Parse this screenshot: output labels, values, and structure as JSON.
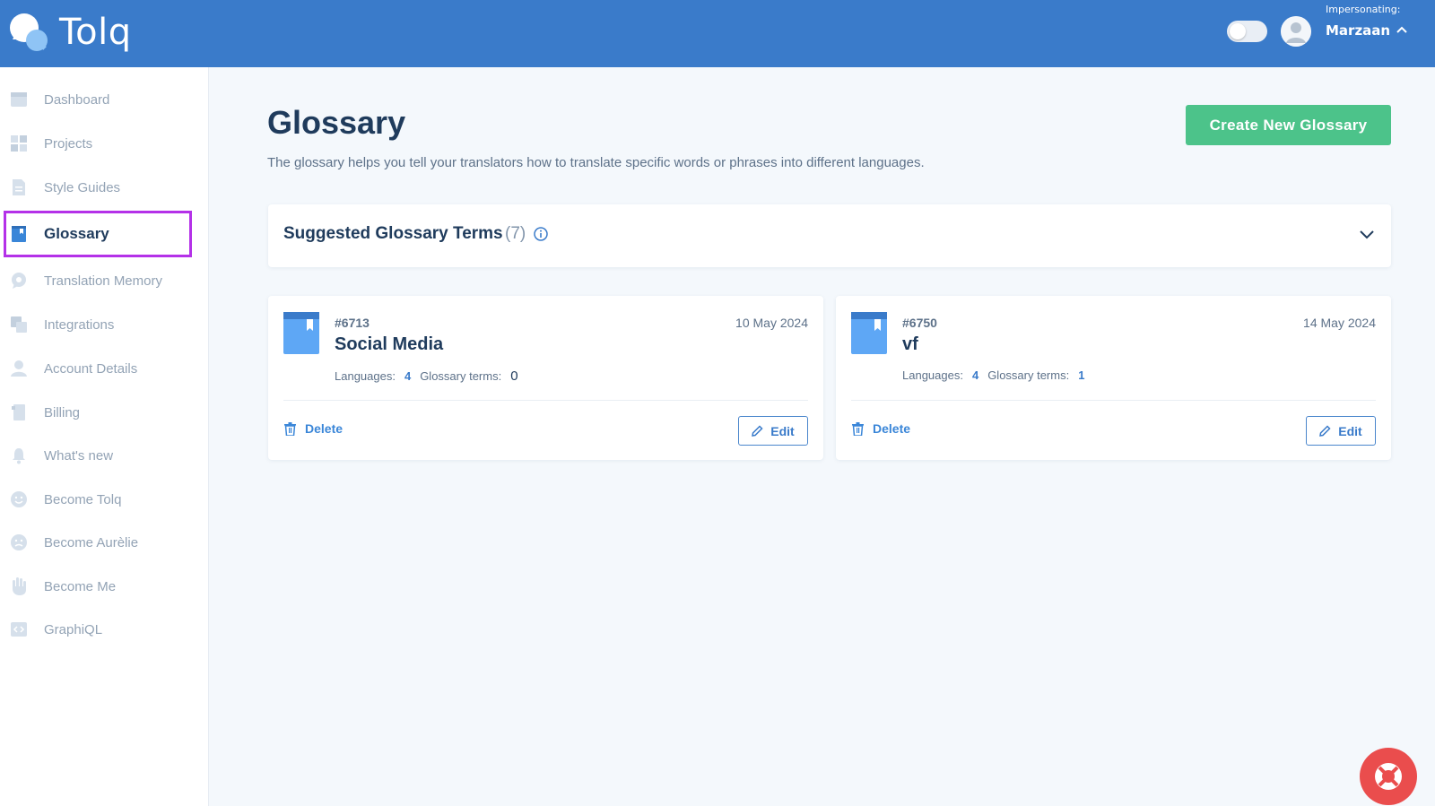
{
  "app": {
    "brand": "Tolq",
    "impersonating_label": "Impersonating:",
    "user_name": "Marzaan"
  },
  "sidebar": {
    "items": [
      {
        "label": "Dashboard",
        "icon": "dashboard-icon"
      },
      {
        "label": "Projects",
        "icon": "projects-grid-icon"
      },
      {
        "label": "Style Guides",
        "icon": "document-icon"
      },
      {
        "label": "Glossary",
        "icon": "book-icon",
        "active": true
      },
      {
        "label": "Translation Memory",
        "icon": "chat-bubble-icon"
      },
      {
        "label": "Integrations",
        "icon": "integrations-icon"
      },
      {
        "label": "Account Details",
        "icon": "person-icon"
      },
      {
        "label": "Billing",
        "icon": "receipt-icon"
      },
      {
        "label": "What's new",
        "icon": "bell-icon"
      },
      {
        "label": "Become Tolq",
        "icon": "smile-face-icon"
      },
      {
        "label": "Become Aurèlie",
        "icon": "sad-face-icon"
      },
      {
        "label": "Become Me",
        "icon": "hand-icon"
      },
      {
        "label": "GraphiQL",
        "icon": "code-icon"
      }
    ]
  },
  "main": {
    "title": "Glossary",
    "description": "The glossary helps you tell your translators how to translate specific words or phrases into different languages.",
    "create_button": "Create New Glossary",
    "suggested": {
      "title": "Suggested Glossary Terms",
      "count": "(7)"
    },
    "cards": [
      {
        "id": "#6713",
        "date": "10 May 2024",
        "name": "Social Media",
        "languages_label": "Languages:",
        "languages": "4",
        "terms_label": "Glossary terms:",
        "terms": "0",
        "delete_label": "Delete",
        "edit_label": "Edit"
      },
      {
        "id": "#6750",
        "date": "14 May 2024",
        "name": "vf",
        "languages_label": "Languages:",
        "languages": "4",
        "terms_label": "Glossary terms:",
        "terms": "1",
        "delete_label": "Delete",
        "edit_label": "Edit"
      }
    ]
  },
  "colors": {
    "header": "#3a7bca",
    "accent_green": "#4cc38a",
    "active_outline": "#b431e8",
    "help_button": "#ea4d4d"
  }
}
